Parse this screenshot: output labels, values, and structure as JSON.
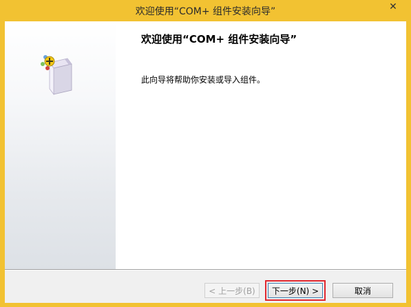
{
  "window": {
    "title": "欢迎使用“COM+ 组件安装向导”"
  },
  "titlebar": {
    "close_glyph": "✕"
  },
  "main": {
    "headline": "欢迎使用“COM+ 组件安装向导”",
    "description": "此向导将帮助你安装或导入组件。"
  },
  "buttons": {
    "back_label": "< 上一步(B)",
    "next_label": "下一步(N) >",
    "cancel_label": "取消"
  },
  "icons": {
    "wizard": "component-box-icon",
    "close": "close-icon"
  },
  "colors": {
    "titlebar": "#f2c232",
    "highlight": "#e0262e"
  }
}
